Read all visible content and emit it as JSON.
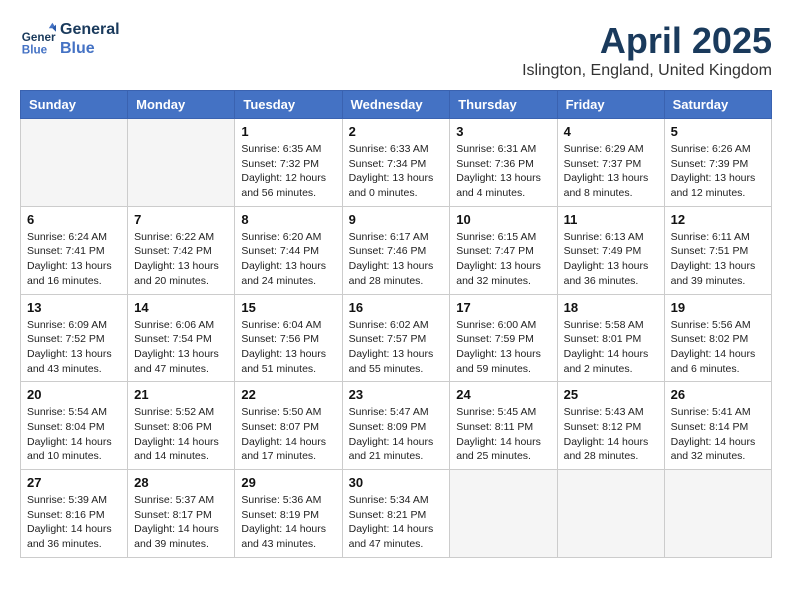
{
  "logo": {
    "line1": "General",
    "line2": "Blue"
  },
  "title": "April 2025",
  "location": "Islington, England, United Kingdom",
  "days_of_week": [
    "Sunday",
    "Monday",
    "Tuesday",
    "Wednesday",
    "Thursday",
    "Friday",
    "Saturday"
  ],
  "weeks": [
    [
      {
        "day": "",
        "info": ""
      },
      {
        "day": "",
        "info": ""
      },
      {
        "day": "1",
        "info": "Sunrise: 6:35 AM\nSunset: 7:32 PM\nDaylight: 12 hours and 56 minutes."
      },
      {
        "day": "2",
        "info": "Sunrise: 6:33 AM\nSunset: 7:34 PM\nDaylight: 13 hours and 0 minutes."
      },
      {
        "day": "3",
        "info": "Sunrise: 6:31 AM\nSunset: 7:36 PM\nDaylight: 13 hours and 4 minutes."
      },
      {
        "day": "4",
        "info": "Sunrise: 6:29 AM\nSunset: 7:37 PM\nDaylight: 13 hours and 8 minutes."
      },
      {
        "day": "5",
        "info": "Sunrise: 6:26 AM\nSunset: 7:39 PM\nDaylight: 13 hours and 12 minutes."
      }
    ],
    [
      {
        "day": "6",
        "info": "Sunrise: 6:24 AM\nSunset: 7:41 PM\nDaylight: 13 hours and 16 minutes."
      },
      {
        "day": "7",
        "info": "Sunrise: 6:22 AM\nSunset: 7:42 PM\nDaylight: 13 hours and 20 minutes."
      },
      {
        "day": "8",
        "info": "Sunrise: 6:20 AM\nSunset: 7:44 PM\nDaylight: 13 hours and 24 minutes."
      },
      {
        "day": "9",
        "info": "Sunrise: 6:17 AM\nSunset: 7:46 PM\nDaylight: 13 hours and 28 minutes."
      },
      {
        "day": "10",
        "info": "Sunrise: 6:15 AM\nSunset: 7:47 PM\nDaylight: 13 hours and 32 minutes."
      },
      {
        "day": "11",
        "info": "Sunrise: 6:13 AM\nSunset: 7:49 PM\nDaylight: 13 hours and 36 minutes."
      },
      {
        "day": "12",
        "info": "Sunrise: 6:11 AM\nSunset: 7:51 PM\nDaylight: 13 hours and 39 minutes."
      }
    ],
    [
      {
        "day": "13",
        "info": "Sunrise: 6:09 AM\nSunset: 7:52 PM\nDaylight: 13 hours and 43 minutes."
      },
      {
        "day": "14",
        "info": "Sunrise: 6:06 AM\nSunset: 7:54 PM\nDaylight: 13 hours and 47 minutes."
      },
      {
        "day": "15",
        "info": "Sunrise: 6:04 AM\nSunset: 7:56 PM\nDaylight: 13 hours and 51 minutes."
      },
      {
        "day": "16",
        "info": "Sunrise: 6:02 AM\nSunset: 7:57 PM\nDaylight: 13 hours and 55 minutes."
      },
      {
        "day": "17",
        "info": "Sunrise: 6:00 AM\nSunset: 7:59 PM\nDaylight: 13 hours and 59 minutes."
      },
      {
        "day": "18",
        "info": "Sunrise: 5:58 AM\nSunset: 8:01 PM\nDaylight: 14 hours and 2 minutes."
      },
      {
        "day": "19",
        "info": "Sunrise: 5:56 AM\nSunset: 8:02 PM\nDaylight: 14 hours and 6 minutes."
      }
    ],
    [
      {
        "day": "20",
        "info": "Sunrise: 5:54 AM\nSunset: 8:04 PM\nDaylight: 14 hours and 10 minutes."
      },
      {
        "day": "21",
        "info": "Sunrise: 5:52 AM\nSunset: 8:06 PM\nDaylight: 14 hours and 14 minutes."
      },
      {
        "day": "22",
        "info": "Sunrise: 5:50 AM\nSunset: 8:07 PM\nDaylight: 14 hours and 17 minutes."
      },
      {
        "day": "23",
        "info": "Sunrise: 5:47 AM\nSunset: 8:09 PM\nDaylight: 14 hours and 21 minutes."
      },
      {
        "day": "24",
        "info": "Sunrise: 5:45 AM\nSunset: 8:11 PM\nDaylight: 14 hours and 25 minutes."
      },
      {
        "day": "25",
        "info": "Sunrise: 5:43 AM\nSunset: 8:12 PM\nDaylight: 14 hours and 28 minutes."
      },
      {
        "day": "26",
        "info": "Sunrise: 5:41 AM\nSunset: 8:14 PM\nDaylight: 14 hours and 32 minutes."
      }
    ],
    [
      {
        "day": "27",
        "info": "Sunrise: 5:39 AM\nSunset: 8:16 PM\nDaylight: 14 hours and 36 minutes."
      },
      {
        "day": "28",
        "info": "Sunrise: 5:37 AM\nSunset: 8:17 PM\nDaylight: 14 hours and 39 minutes."
      },
      {
        "day": "29",
        "info": "Sunrise: 5:36 AM\nSunset: 8:19 PM\nDaylight: 14 hours and 43 minutes."
      },
      {
        "day": "30",
        "info": "Sunrise: 5:34 AM\nSunset: 8:21 PM\nDaylight: 14 hours and 47 minutes."
      },
      {
        "day": "",
        "info": ""
      },
      {
        "day": "",
        "info": ""
      },
      {
        "day": "",
        "info": ""
      }
    ]
  ]
}
